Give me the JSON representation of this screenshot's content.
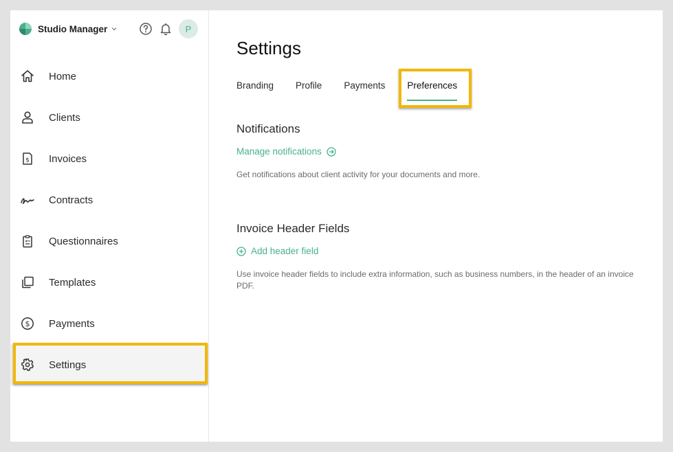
{
  "header": {
    "brand_name": "Studio Manager",
    "avatar_initial": "P"
  },
  "sidebar": {
    "items": [
      {
        "label": "Home",
        "icon": "home-icon"
      },
      {
        "label": "Clients",
        "icon": "user-icon"
      },
      {
        "label": "Invoices",
        "icon": "invoice-icon"
      },
      {
        "label": "Contracts",
        "icon": "signature-icon"
      },
      {
        "label": "Questionnaires",
        "icon": "clipboard-icon"
      },
      {
        "label": "Templates",
        "icon": "templates-icon"
      },
      {
        "label": "Payments",
        "icon": "dollar-icon"
      },
      {
        "label": "Settings",
        "icon": "gear-icon",
        "active": true
      }
    ]
  },
  "main": {
    "title": "Settings",
    "tabs": [
      {
        "label": "Branding"
      },
      {
        "label": "Profile"
      },
      {
        "label": "Payments"
      },
      {
        "label": "Preferences",
        "active": true
      }
    ],
    "notifications": {
      "title": "Notifications",
      "link_label": "Manage notifications",
      "description": "Get notifications about client activity for your documents and more."
    },
    "invoice_header": {
      "title": "Invoice Header Fields",
      "link_label": "Add header field",
      "description": "Use invoice header fields to include extra information, such as business numbers, in the header of an invoice PDF."
    }
  },
  "colors": {
    "accent": "#49b08c",
    "highlight": "#f2b705",
    "avatar_bg": "#dcebe5"
  }
}
